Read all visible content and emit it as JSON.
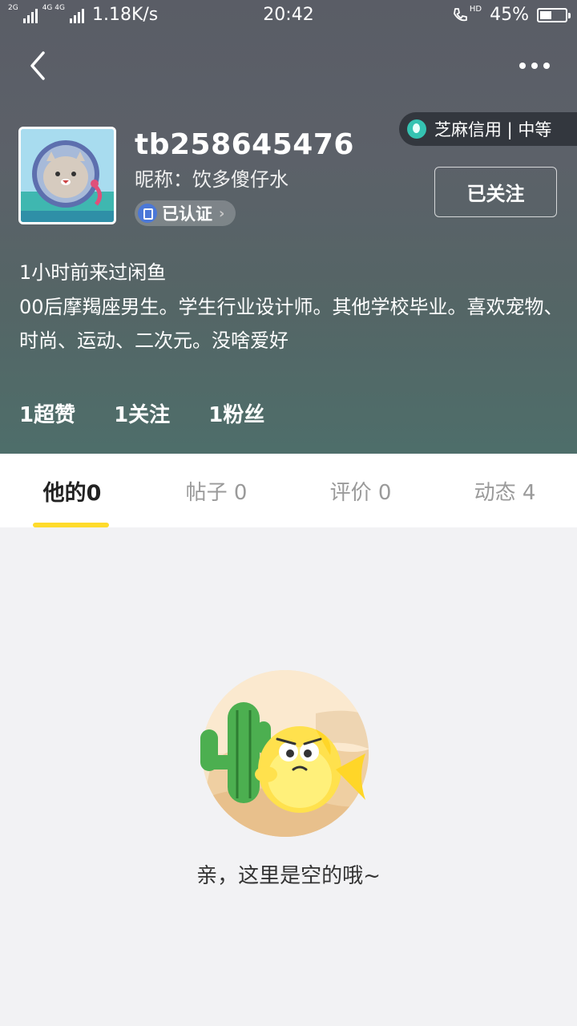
{
  "status_bar": {
    "net_tag_1": "2G",
    "net_tag_2": "4G 4G",
    "speed": "1.18K/s",
    "time": "20:42",
    "call_tag": "HD",
    "battery_percent": "45%",
    "battery_level": 0.45
  },
  "nav": {
    "back_icon": "chevron-left-icon",
    "more_icon": "more-dots-icon"
  },
  "credit": {
    "label": "芝麻信用 | 中等",
    "icon": "sesame-credit-icon",
    "accent": "#35c3b2"
  },
  "profile": {
    "username": "tb258645476",
    "nickname": "昵称：饮多傻仔水",
    "verified_label": "已认证",
    "follow_label": "已关注",
    "last_seen": "1小时前来过闲鱼",
    "bio": "00后摩羯座男生。学生行业设计师。其他学校毕业。喜欢宠物、时尚、运动、二次元。没啥爱好"
  },
  "stats": [
    {
      "label": "1超赞"
    },
    {
      "label": "1关注"
    },
    {
      "label": "1粉丝"
    }
  ],
  "tabs": [
    {
      "label": "他的0",
      "active": true
    },
    {
      "label": "帖子 0",
      "active": false
    },
    {
      "label": "评价 0",
      "active": false
    },
    {
      "label": "动态 4",
      "active": false
    }
  ],
  "empty_state": {
    "illustration": "cactus-fish-illustration",
    "message": "亲，这里是空的哦~"
  },
  "colors": {
    "tab_underline": "#ffdb2b",
    "verified_badge": "#4b78d8"
  }
}
